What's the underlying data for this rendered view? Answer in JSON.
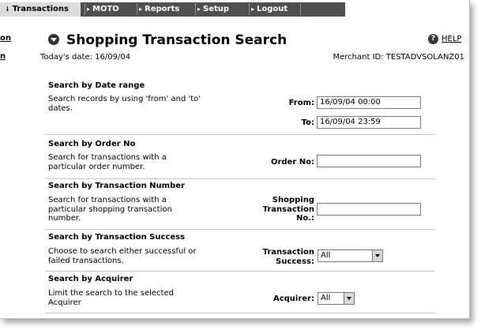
{
  "nav": {
    "tabs": [
      {
        "label": "Transactions",
        "arrow": "↓",
        "active": true
      },
      {
        "label": "MOTO",
        "arrow": "▸"
      },
      {
        "label": "Reports",
        "arrow": "▸"
      },
      {
        "label": "Setup",
        "arrow": "▸"
      },
      {
        "label": "Logout",
        "arrow": "▸"
      }
    ]
  },
  "sidebar": {
    "links": [
      "on",
      "n"
    ]
  },
  "header": {
    "title": "Shopping Transaction Search",
    "help_label": "HELP",
    "today": "Today's date: 16/09/04",
    "merchant": "Merchant ID: TESTADVSOLANZ01"
  },
  "sections": {
    "date": {
      "title": "Search by Date range",
      "desc": "Search records by using 'from' and 'to' dates.",
      "from_label": "From:",
      "from_value": "16/09/04 00:00",
      "to_label": "To:",
      "to_value": "16/09/04 23:59"
    },
    "order": {
      "title": "Search by Order No",
      "desc": "Search for transactions with a particular order number.",
      "label": "Order No:",
      "value": ""
    },
    "txn_number": {
      "title": "Search by Transaction Number",
      "desc": "Search for transactions with a particular shopping transaction number.",
      "label_line1": "Shopping",
      "label_line2": "Transaction",
      "label_line3": "No.:",
      "value": ""
    },
    "success": {
      "title": "Search by Transaction Success",
      "desc": "Choose to search either successful or failed transactions.",
      "label_line1": "Transaction",
      "label_line2": "Success:",
      "selected": "All"
    },
    "acquirer": {
      "title": "Search by Acquirer",
      "desc": "Limit the search to the selected Acquirer",
      "label": "Acquirer:",
      "selected": "All"
    }
  }
}
